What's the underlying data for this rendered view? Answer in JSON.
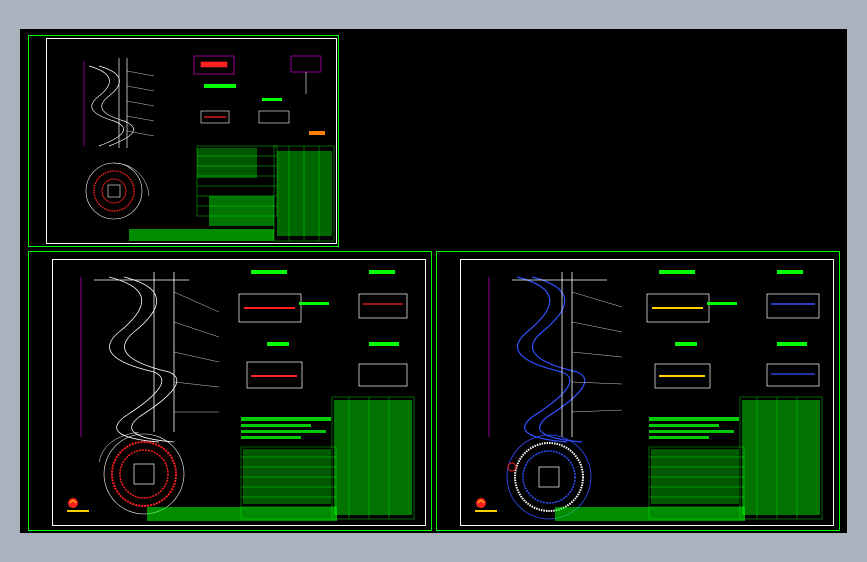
{
  "window": {
    "title": ""
  },
  "viewport": {
    "background": "#000000",
    "frame_color": "#00ff00",
    "outline_color": "#ffffff"
  },
  "sheets": [
    {
      "id": "sheet-1",
      "type": "helical stair drawing (small scale)"
    },
    {
      "id": "sheet-2",
      "type": "helical stair drawing (left)"
    },
    {
      "id": "sheet-3",
      "type": "helical stair drawing (right)"
    }
  ],
  "colors": {
    "table_text": "#00ff00",
    "dimension": "#ff00ff",
    "rebar": "#ff2020",
    "blue_detail": "#3050ff",
    "outline": "#ffffff",
    "frame": "#00ff00"
  },
  "icons": [
    "cad-logo-icon"
  ]
}
